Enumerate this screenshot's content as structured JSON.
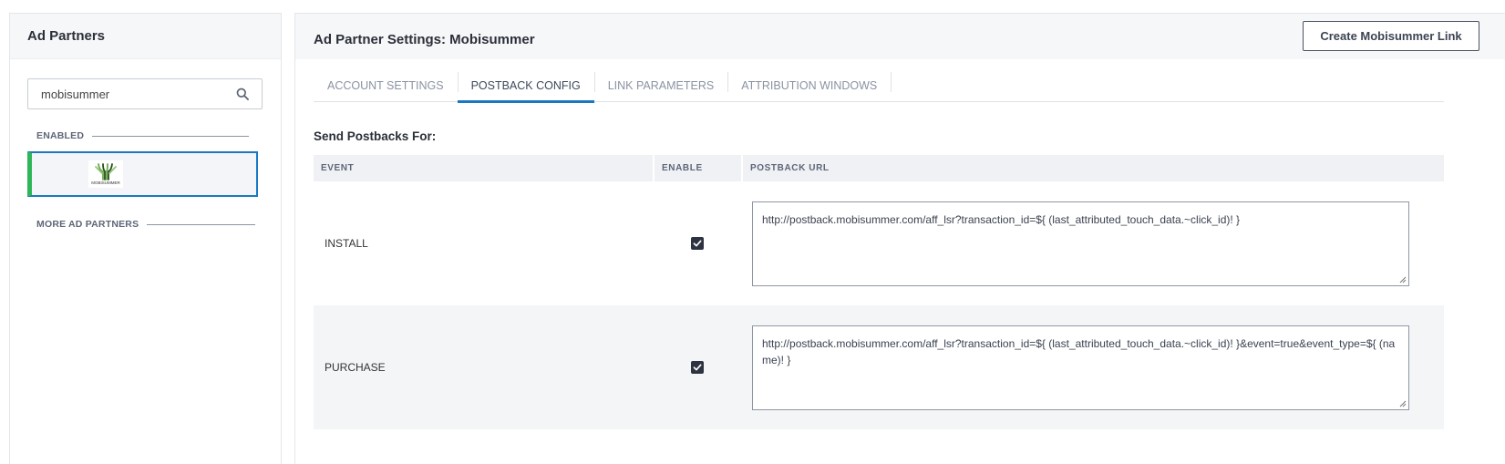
{
  "sidebar": {
    "title": "Ad Partners",
    "search": {
      "value": "mobisummer"
    },
    "enabled_label": "ENABLED",
    "more_label": "MORE AD PARTNERS",
    "partner": {
      "logo_text": "MOBISUMMER"
    }
  },
  "main": {
    "title": "Ad Partner Settings: Mobisummer",
    "create_button": "Create Mobisummer Link",
    "tabs": [
      {
        "label": "ACCOUNT SETTINGS"
      },
      {
        "label": "POSTBACK CONFIG"
      },
      {
        "label": "LINK PARAMETERS"
      },
      {
        "label": "ATTRIBUTION WINDOWS"
      }
    ],
    "active_tab": "POSTBACK CONFIG",
    "section_title": "Send Postbacks For:",
    "table": {
      "headers": [
        "EVENT",
        "ENABLE",
        "POSTBACK URL"
      ],
      "rows": [
        {
          "event": "INSTALL",
          "enabled": true,
          "url": "http://postback.mobisummer.com/aff_lsr?transaction_id=${ (last_attributed_touch_data.~click_id)! }"
        },
        {
          "event": "PURCHASE",
          "enabled": true,
          "url": "http://postback.mobisummer.com/aff_lsr?transaction_id=${ (last_attributed_touch_data.~click_id)! }&event=true&event_type=${ (name)! }"
        }
      ]
    }
  },
  "colors": {
    "accent": "#1a78c2",
    "enabled_bar": "#2fb659"
  }
}
